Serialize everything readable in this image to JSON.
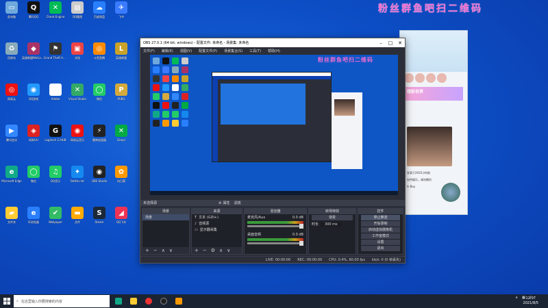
{
  "watermark": "粉丝群鱼吧扫二维码",
  "desktop_icons": [
    {
      "label": "此电脑",
      "color": "#6fa8dc",
      "glyph": "▭"
    },
    {
      "label": "腾讯QQ",
      "color": "#111",
      "glyph": "Q"
    },
    {
      "label": "Cheat Engine",
      "color": "#0b5",
      "glyph": "✕"
    },
    {
      "label": "QQ截图",
      "color": "#ccc",
      "glyph": "▤"
    },
    {
      "label": "百度网盘",
      "color": "#2a7fff",
      "glyph": "☁"
    },
    {
      "label": "飞书",
      "color": "#3a7bff",
      "glyph": "✈"
    },
    {
      "label": "回收站",
      "color": "#8ab",
      "glyph": "♻"
    },
    {
      "label": "英雄联盟WeGame",
      "color": "#a36",
      "glyph": "◆"
    },
    {
      "label": "Grand Theft Auto",
      "color": "#333",
      "glyph": "⚑"
    },
    {
      "label": "文档",
      "color": "#e44",
      "glyph": "▣"
    },
    {
      "label": "斗鱼直播",
      "color": "#ff8a00",
      "glyph": "◎"
    },
    {
      "label": "英雄联盟",
      "color": "#c9a227",
      "glyph": "L"
    },
    {
      "label": "网易云",
      "color": "#e11",
      "glyph": "◎"
    },
    {
      "label": "QQ游戏",
      "color": "#29f",
      "glyph": "◉"
    },
    {
      "label": "Adobe",
      "color": "#fff",
      "glyph": "A"
    },
    {
      "label": "Visual Studio",
      "color": "#3a6",
      "glyph": "✕"
    },
    {
      "label": "微信",
      "color": "#2c6",
      "glyph": "◯"
    },
    {
      "label": "PUBG",
      "color": "#d4aa3c",
      "glyph": "P"
    },
    {
      "label": "腾讯会议",
      "color": "#38f",
      "glyph": "▶"
    },
    {
      "label": "网易UU",
      "color": "#d22",
      "glyph": "◈"
    },
    {
      "label": "Logitech G HUB",
      "color": "#111",
      "glyph": "G"
    },
    {
      "label": "网易云音乐",
      "color": "#e11",
      "glyph": "◉"
    },
    {
      "label": "雷神加速器",
      "color": "#222",
      "glyph": "⚡"
    },
    {
      "label": "Deepl",
      "color": "#0a4",
      "glyph": "✕"
    },
    {
      "label": "Microsoft Edge",
      "color": "#1a8",
      "glyph": "e"
    },
    {
      "label": "微信",
      "color": "#2c6",
      "glyph": "◯"
    },
    {
      "label": "QQ音乐",
      "color": "#2c6",
      "glyph": "♫"
    },
    {
      "label": "Battle.net",
      "color": "#1589f0",
      "glyph": "✦"
    },
    {
      "label": "OBS Studio",
      "color": "#222",
      "glyph": "◉"
    },
    {
      "label": "向日葵",
      "color": "#f90",
      "glyph": "✿"
    },
    {
      "label": "文件夹",
      "color": "#fc3",
      "glyph": "▰"
    },
    {
      "label": "IE浏览器",
      "color": "#2a7fff",
      "glyph": "e"
    },
    {
      "label": "Wallpaper",
      "color": "#3b6",
      "glyph": "✔"
    },
    {
      "label": "文件",
      "color": "#fa0",
      "glyph": "▬"
    },
    {
      "label": "Steam",
      "color": "#1b2838",
      "glyph": "S"
    },
    {
      "label": "QQ飞车",
      "color": "#e35",
      "glyph": "◢"
    }
  ],
  "obs": {
    "title": "OBS 27.0.1 (64-bit, windows) - 配置文件: 未命名 - 场景集: 未命名",
    "menu": [
      "文件(F)",
      "编辑(E)",
      "视图(V)",
      "配置文件(P)",
      "场景集合(S)",
      "工具(T)",
      "帮助(H)"
    ],
    "preview_watermark": "粉丝群鱼吧扫二维码",
    "dock_header": "未选择源",
    "dock_header_props": "属性",
    "dock_header_filters": "滤镜",
    "scenes_title": "场景",
    "scenes": [
      "场景"
    ],
    "sources_title": "来源",
    "sources": [
      "文本 (GDI+)",
      "音频源",
      "显示器采集"
    ],
    "mixer_title": "混音器",
    "mixer": [
      {
        "name": "麦克风/Aux",
        "db": "0.0 dB"
      },
      {
        "name": "桌面音频",
        "db": "0.0 dB"
      }
    ],
    "transitions_title": "转场特效",
    "transition_value": "渐变",
    "duration_label": "时长",
    "duration_value": "300 ms",
    "controls_title": "控件",
    "controls": [
      "停止推流",
      "开始录制",
      "启动虚拟摄像机",
      "工作室模式",
      "设置",
      "退出"
    ],
    "status": {
      "live": "LIVE: 00:00:00",
      "rec": "REC: 00:00:00",
      "cpu": "CPU: 0.4%, 60.00 fps",
      "kbps": "kb/s: 0 (0 帧丢失)"
    }
  },
  "chat": {
    "banner": "精彩世界",
    "lines": [
      "发表于2025小时前",
      "仅供娱乐，请勿模仿",
      "Is Boy"
    ]
  },
  "taskbar": {
    "search_placeholder": "在这里输入你要搜索的内容",
    "time": "12:07",
    "date": "2021/8/5"
  }
}
